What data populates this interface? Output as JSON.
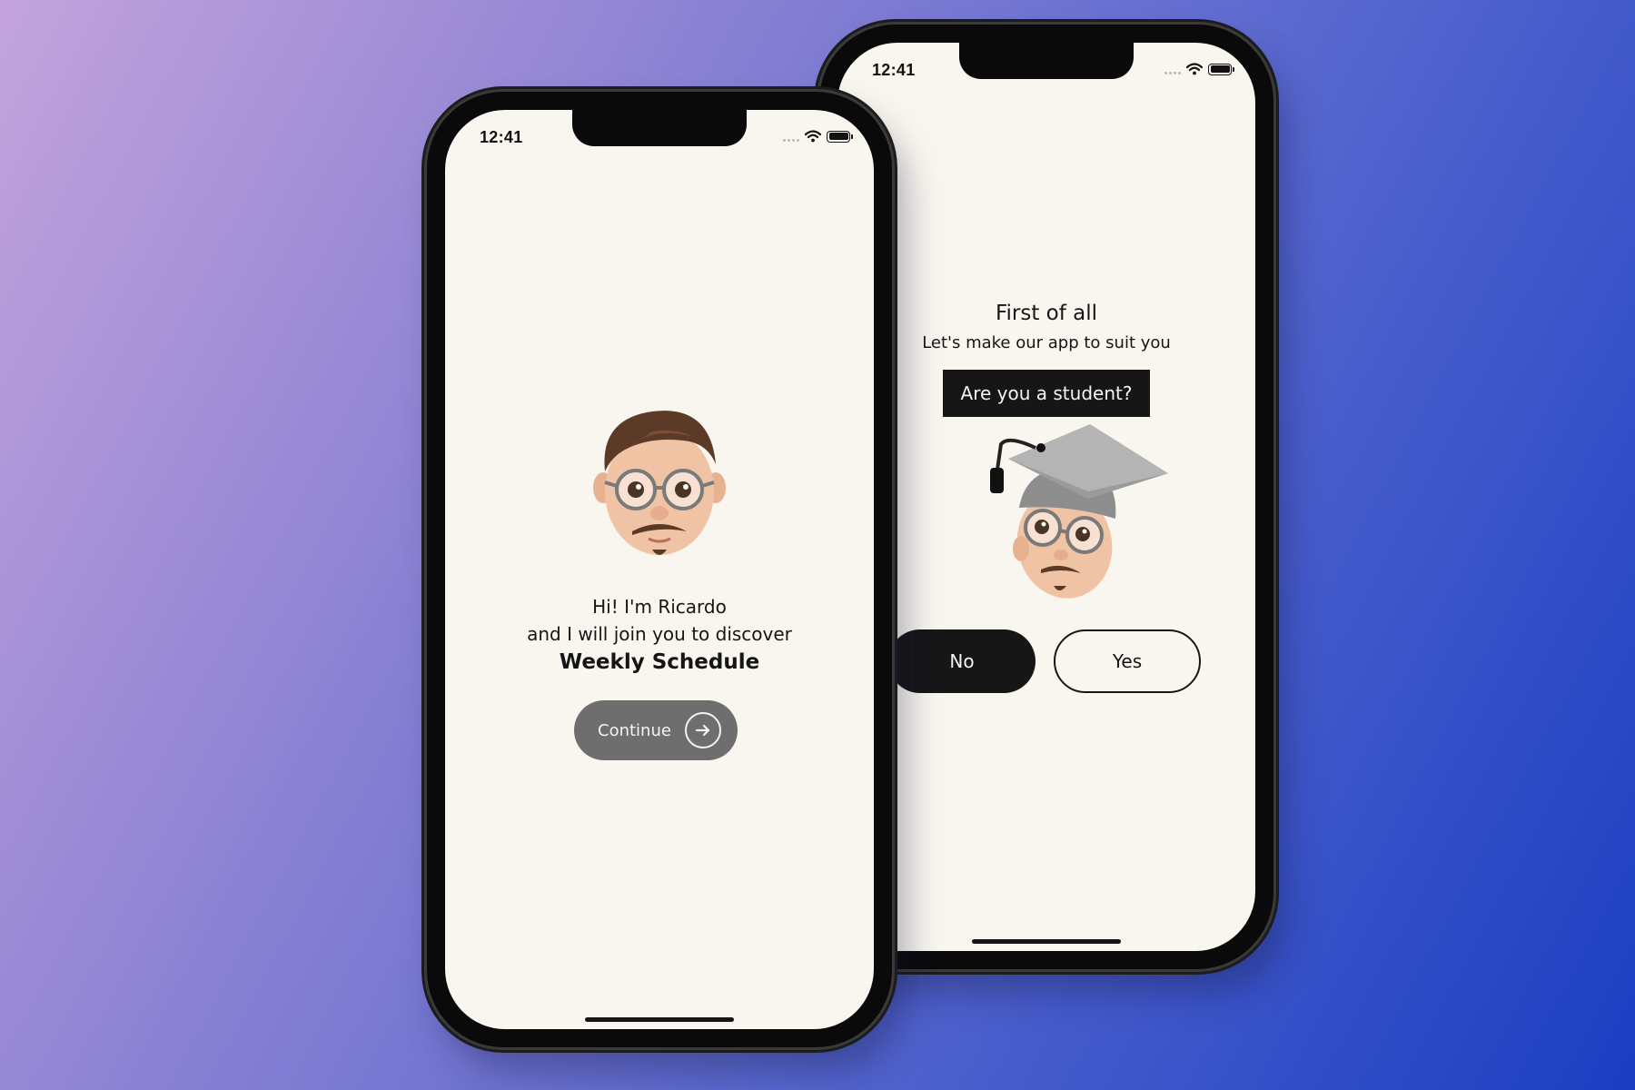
{
  "phones": {
    "welcome": {
      "status_time": "12:41",
      "greeting_line1": "Hi! I'm Ricardo",
      "greeting_line2": "and I will join you to discover",
      "app_name": "Weekly Schedule",
      "continue_label": "Continue",
      "icons": {
        "continue": "arrow-right-circle-icon",
        "wifi": "wifi-icon",
        "battery": "battery-icon"
      }
    },
    "question": {
      "status_time": "12:41",
      "title": "First of all",
      "subtitle": "Let's make our app to suit you",
      "question": "Are you a student?",
      "no_label": "No",
      "yes_label": "Yes",
      "icons": {
        "wifi": "wifi-icon",
        "battery": "battery-icon"
      }
    }
  },
  "colors": {
    "screen_bg": "#f9f6ef",
    "primary_dark": "#161616",
    "continue_bg": "#6e6e6e",
    "background_gradient_start": "#c3a3dc",
    "background_gradient_end": "#1a3ec2"
  }
}
